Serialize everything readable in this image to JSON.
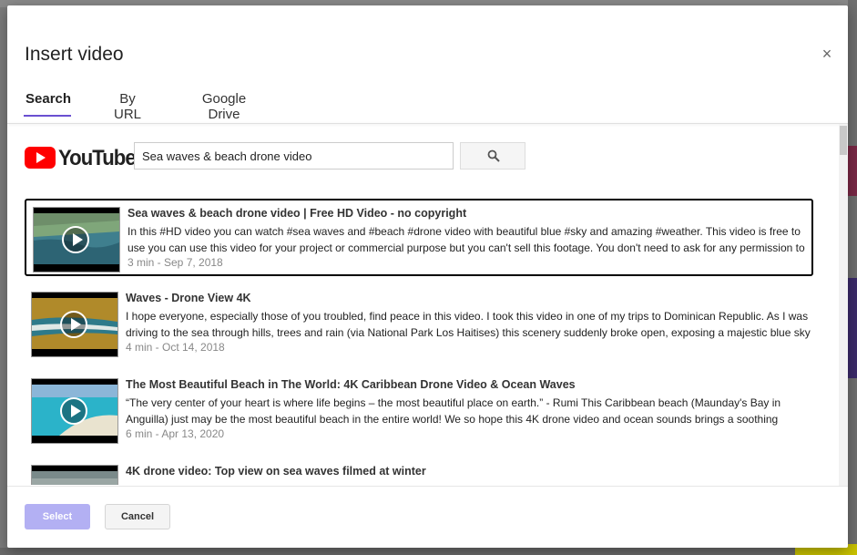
{
  "dialog": {
    "title": "Insert video",
    "close_glyph": "×"
  },
  "tabs": [
    {
      "label": "Search",
      "active": true
    },
    {
      "label": "By URL",
      "active": false
    },
    {
      "label": "Google Drive",
      "active": false
    }
  ],
  "youtube": {
    "logo_text": "YouTube",
    "logo_color": "#ff0000"
  },
  "search": {
    "value": "Sea waves & beach drone video",
    "button_icon": "search-icon"
  },
  "results": [
    {
      "title": "Sea waves & beach drone video | Free HD Video - no copyright",
      "description": "In this #HD video you can watch #sea waves and #beach #drone video with beautiful blue #sky and amazing #weather. This video is free to use you can use this video for your project or commercial purpose but you can't sell this footage. You don't need to ask for any permission to",
      "meta": "3 min - Sep 7, 2018",
      "selected": true
    },
    {
      "title": "Waves - Drone View 4K",
      "description": "I hope everyone, especially those of you troubled, find peace in this video. I took this video in one of my trips to Dominican Republic. As I was driving to the sea through hills, trees and rain (via National Park Los Haitises) this scenery suddenly broke open, exposing a majestic blue sky",
      "meta": "4 min - Oct 14, 2018",
      "selected": false
    },
    {
      "title": "The Most Beautiful Beach in The World: 4K Caribbean Drone Video & Ocean Waves",
      "description": "“The very center of your heart is where life begins – the most beautiful place on earth.” - Rumi This Caribbean beach (Maunday's Bay in Anguilla) just may be the most beautiful beach in the entire world! We so hope this 4K drone video and ocean sounds brings a soothing",
      "meta": "6 min - Apr 13, 2020",
      "selected": false
    },
    {
      "title": "4K drone video: Top view on sea waves filmed at winter",
      "description": "",
      "meta": "",
      "selected": false
    }
  ],
  "footer": {
    "select_label": "Select",
    "cancel_label": "Cancel"
  },
  "colors": {
    "accent": "#6a4fd1",
    "select_button": "#b3b0f3"
  }
}
